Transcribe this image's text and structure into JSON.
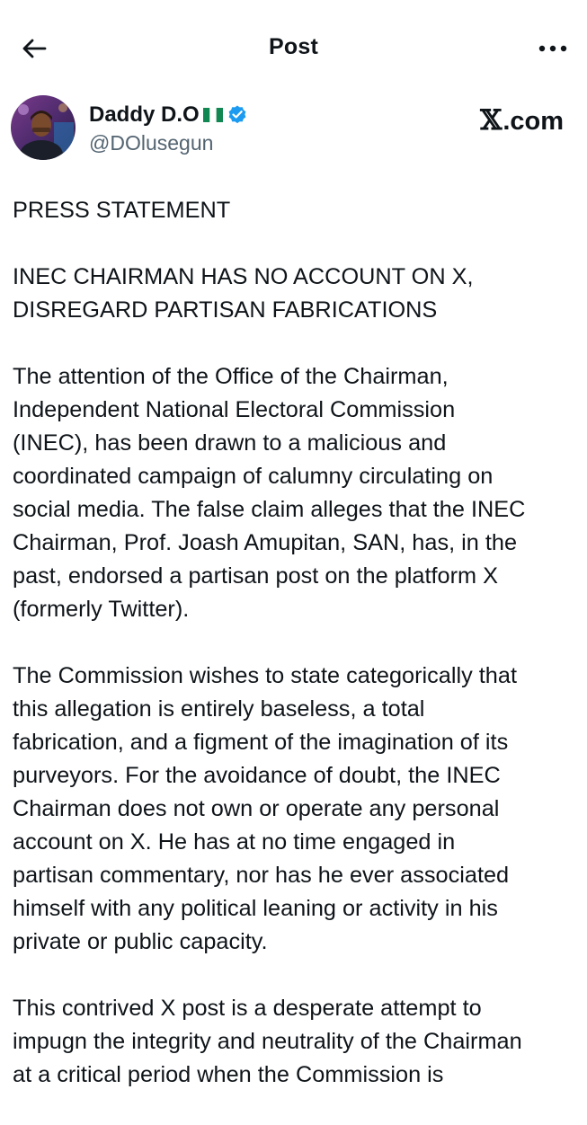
{
  "header": {
    "title": "Post",
    "back_icon": "arrow-left-icon",
    "more_icon": "more-horizontal-icon"
  },
  "author": {
    "display_name": "Daddy D.O",
    "flag_emoji": "nigeria-flag-icon",
    "verified": true,
    "handle": "@DOlusegun",
    "verified_color": "#1d9bf0"
  },
  "brand": {
    "mark": "𝕏",
    "label": ".com"
  },
  "post": {
    "paragraphs": [
      {
        "lines": [
          "PRESS STATEMENT"
        ]
      },
      {
        "lines": [
          "INEC CHAIRMAN HAS NO ACCOUNT ON X,",
          "DISREGARD PARTISAN FABRICATIONS"
        ]
      },
      {
        "lines": [
          "The attention of the Office of the Chairman,",
          "Independent National Electoral Commission",
          "(INEC), has been drawn to a malicious and",
          "coordinated campaign of calumny circulating on",
          "social media. The false claim alleges that the INEC",
          "Chairman, Prof. Joash Amupitan, SAN, has, in the",
          "past, endorsed a partisan post on the platform X",
          "(formerly Twitter)."
        ]
      },
      {
        "lines": [
          "The Commission wishes to state categorically that",
          "this allegation is entirely baseless, a total",
          "fabrication, and a figment of the imagination of its",
          "purveyors. For the avoidance of doubt, the INEC",
          "Chairman does not own or operate any personal",
          "account on X. He has at no time engaged in",
          "partisan commentary, nor has he ever associated",
          "himself with any political leaning or activity in his",
          "private or public capacity."
        ]
      },
      {
        "lines": [
          "This contrived X post is a desperate attempt to",
          "impugn the integrity and neutrality of the Chairman",
          "at a critical period when the Commission is"
        ]
      }
    ]
  }
}
